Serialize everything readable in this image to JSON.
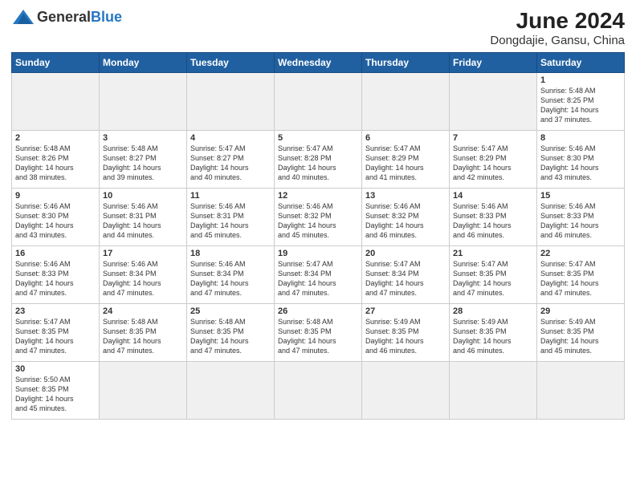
{
  "header": {
    "logo_general": "General",
    "logo_blue": "Blue",
    "month_year": "June 2024",
    "location": "Dongdajie, Gansu, China"
  },
  "weekdays": [
    "Sunday",
    "Monday",
    "Tuesday",
    "Wednesday",
    "Thursday",
    "Friday",
    "Saturday"
  ],
  "days": [
    {
      "num": "",
      "info": "",
      "empty": true
    },
    {
      "num": "",
      "info": "",
      "empty": true
    },
    {
      "num": "",
      "info": "",
      "empty": true
    },
    {
      "num": "",
      "info": "",
      "empty": true
    },
    {
      "num": "",
      "info": "",
      "empty": true
    },
    {
      "num": "",
      "info": "",
      "empty": true
    },
    {
      "num": "1",
      "info": "Sunrise: 5:48 AM\nSunset: 8:25 PM\nDaylight: 14 hours\nand 37 minutes.",
      "empty": false
    },
    {
      "num": "2",
      "info": "Sunrise: 5:48 AM\nSunset: 8:26 PM\nDaylight: 14 hours\nand 38 minutes.",
      "empty": false
    },
    {
      "num": "3",
      "info": "Sunrise: 5:48 AM\nSunset: 8:27 PM\nDaylight: 14 hours\nand 39 minutes.",
      "empty": false
    },
    {
      "num": "4",
      "info": "Sunrise: 5:47 AM\nSunset: 8:27 PM\nDaylight: 14 hours\nand 40 minutes.",
      "empty": false
    },
    {
      "num": "5",
      "info": "Sunrise: 5:47 AM\nSunset: 8:28 PM\nDaylight: 14 hours\nand 40 minutes.",
      "empty": false
    },
    {
      "num": "6",
      "info": "Sunrise: 5:47 AM\nSunset: 8:29 PM\nDaylight: 14 hours\nand 41 minutes.",
      "empty": false
    },
    {
      "num": "7",
      "info": "Sunrise: 5:47 AM\nSunset: 8:29 PM\nDaylight: 14 hours\nand 42 minutes.",
      "empty": false
    },
    {
      "num": "8",
      "info": "Sunrise: 5:46 AM\nSunset: 8:30 PM\nDaylight: 14 hours\nand 43 minutes.",
      "empty": false
    },
    {
      "num": "9",
      "info": "Sunrise: 5:46 AM\nSunset: 8:30 PM\nDaylight: 14 hours\nand 43 minutes.",
      "empty": false
    },
    {
      "num": "10",
      "info": "Sunrise: 5:46 AM\nSunset: 8:31 PM\nDaylight: 14 hours\nand 44 minutes.",
      "empty": false
    },
    {
      "num": "11",
      "info": "Sunrise: 5:46 AM\nSunset: 8:31 PM\nDaylight: 14 hours\nand 45 minutes.",
      "empty": false
    },
    {
      "num": "12",
      "info": "Sunrise: 5:46 AM\nSunset: 8:32 PM\nDaylight: 14 hours\nand 45 minutes.",
      "empty": false
    },
    {
      "num": "13",
      "info": "Sunrise: 5:46 AM\nSunset: 8:32 PM\nDaylight: 14 hours\nand 46 minutes.",
      "empty": false
    },
    {
      "num": "14",
      "info": "Sunrise: 5:46 AM\nSunset: 8:33 PM\nDaylight: 14 hours\nand 46 minutes.",
      "empty": false
    },
    {
      "num": "15",
      "info": "Sunrise: 5:46 AM\nSunset: 8:33 PM\nDaylight: 14 hours\nand 46 minutes.",
      "empty": false
    },
    {
      "num": "16",
      "info": "Sunrise: 5:46 AM\nSunset: 8:33 PM\nDaylight: 14 hours\nand 47 minutes.",
      "empty": false
    },
    {
      "num": "17",
      "info": "Sunrise: 5:46 AM\nSunset: 8:34 PM\nDaylight: 14 hours\nand 47 minutes.",
      "empty": false
    },
    {
      "num": "18",
      "info": "Sunrise: 5:46 AM\nSunset: 8:34 PM\nDaylight: 14 hours\nand 47 minutes.",
      "empty": false
    },
    {
      "num": "19",
      "info": "Sunrise: 5:47 AM\nSunset: 8:34 PM\nDaylight: 14 hours\nand 47 minutes.",
      "empty": false
    },
    {
      "num": "20",
      "info": "Sunrise: 5:47 AM\nSunset: 8:34 PM\nDaylight: 14 hours\nand 47 minutes.",
      "empty": false
    },
    {
      "num": "21",
      "info": "Sunrise: 5:47 AM\nSunset: 8:35 PM\nDaylight: 14 hours\nand 47 minutes.",
      "empty": false
    },
    {
      "num": "22",
      "info": "Sunrise: 5:47 AM\nSunset: 8:35 PM\nDaylight: 14 hours\nand 47 minutes.",
      "empty": false
    },
    {
      "num": "23",
      "info": "Sunrise: 5:47 AM\nSunset: 8:35 PM\nDaylight: 14 hours\nand 47 minutes.",
      "empty": false
    },
    {
      "num": "24",
      "info": "Sunrise: 5:48 AM\nSunset: 8:35 PM\nDaylight: 14 hours\nand 47 minutes.",
      "empty": false
    },
    {
      "num": "25",
      "info": "Sunrise: 5:48 AM\nSunset: 8:35 PM\nDaylight: 14 hours\nand 47 minutes.",
      "empty": false
    },
    {
      "num": "26",
      "info": "Sunrise: 5:48 AM\nSunset: 8:35 PM\nDaylight: 14 hours\nand 47 minutes.",
      "empty": false
    },
    {
      "num": "27",
      "info": "Sunrise: 5:49 AM\nSunset: 8:35 PM\nDaylight: 14 hours\nand 46 minutes.",
      "empty": false
    },
    {
      "num": "28",
      "info": "Sunrise: 5:49 AM\nSunset: 8:35 PM\nDaylight: 14 hours\nand 46 minutes.",
      "empty": false
    },
    {
      "num": "29",
      "info": "Sunrise: 5:49 AM\nSunset: 8:35 PM\nDaylight: 14 hours\nand 45 minutes.",
      "empty": false
    },
    {
      "num": "30",
      "info": "Sunrise: 5:50 AM\nSunset: 8:35 PM\nDaylight: 14 hours\nand 45 minutes.",
      "empty": false
    },
    {
      "num": "",
      "info": "",
      "empty": true
    },
    {
      "num": "",
      "info": "",
      "empty": true
    },
    {
      "num": "",
      "info": "",
      "empty": true
    },
    {
      "num": "",
      "info": "",
      "empty": true
    },
    {
      "num": "",
      "info": "",
      "empty": true
    },
    {
      "num": "",
      "info": "",
      "empty": true
    }
  ]
}
